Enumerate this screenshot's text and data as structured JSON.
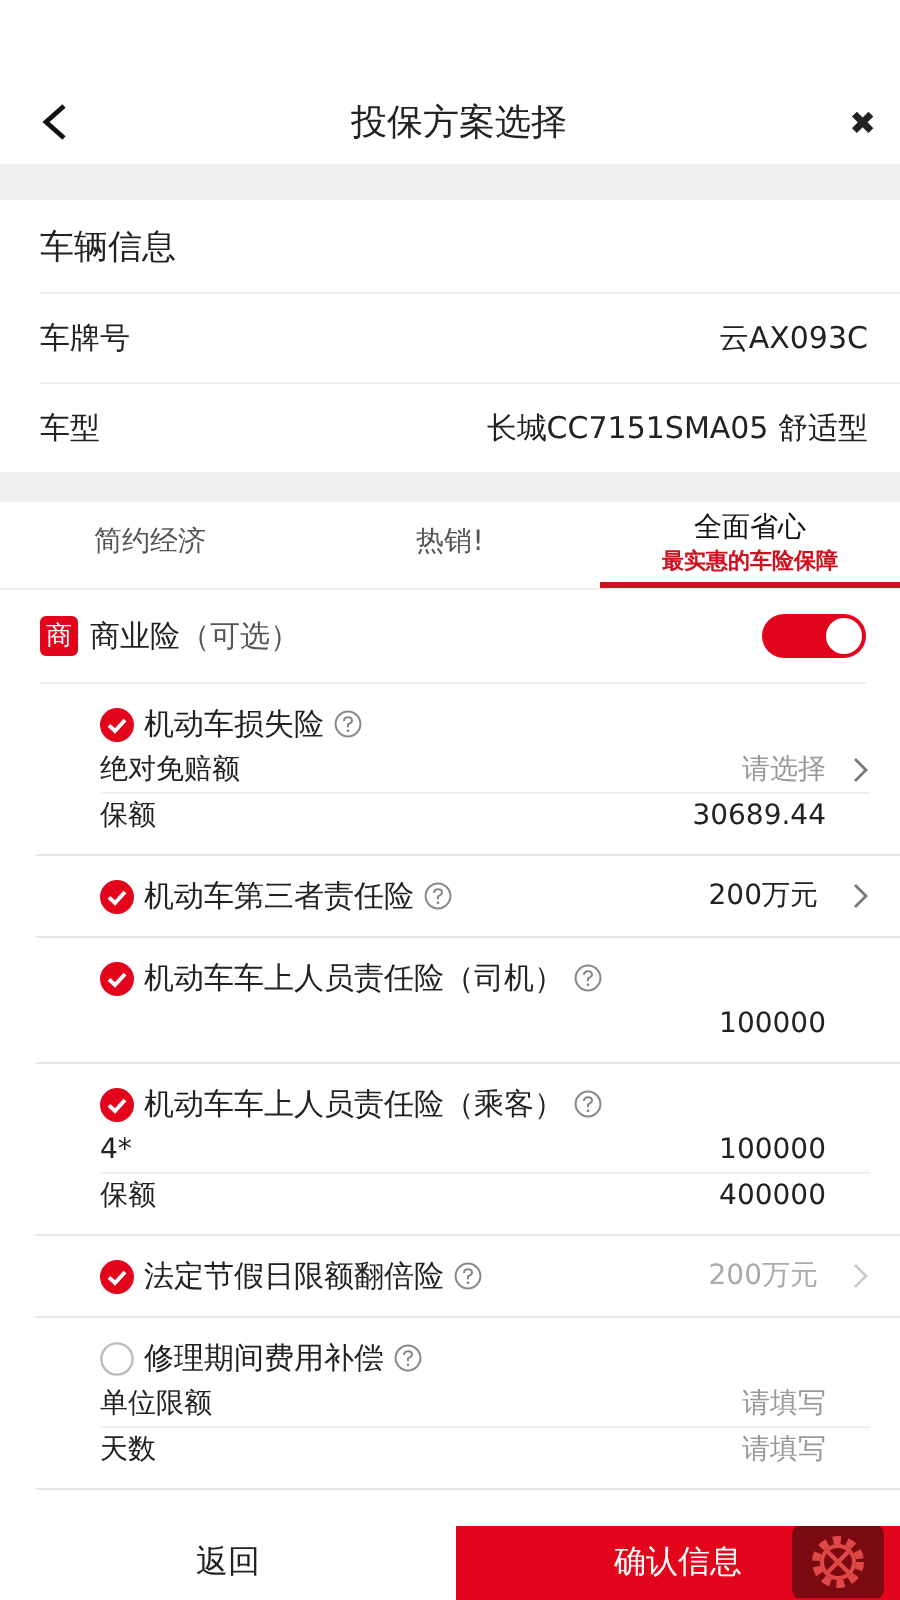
{
  "header": {
    "title": "投保方案选择",
    "close": "✖"
  },
  "vehicle": {
    "heading": "车辆信息",
    "rows": [
      {
        "label": "车牌号",
        "value": "云AX093C"
      },
      {
        "label": "车型",
        "value": "长城CC7151SMA05 舒适型"
      }
    ]
  },
  "tabs": [
    {
      "label": "简约经济",
      "selected": false
    },
    {
      "label": "热销!",
      "selected": false
    },
    {
      "label": "全面省心",
      "subtitle": "最实惠的车险保障",
      "selected": true
    }
  ],
  "commercial": {
    "badge": "商",
    "label": "商业险",
    "note": "（可选）",
    "on": true
  },
  "items": [
    {
      "name": "机动车损失险",
      "checked": true,
      "rows": [
        {
          "kind": "select",
          "label": "绝对免赔额",
          "placeholder": "请选择"
        },
        {
          "kind": "text",
          "label": "保额",
          "value": "30689.44"
        }
      ]
    },
    {
      "name": "机动车第三者责任险",
      "checked": true,
      "value": {
        "text": "200万元",
        "muted": false
      }
    },
    {
      "name": "机动车车上人员责任险（司机）",
      "checked": true,
      "rows": [
        {
          "kind": "text",
          "value": "100000"
        }
      ]
    },
    {
      "name": "机动车车上人员责任险（乘客）",
      "checked": true,
      "rows": [
        {
          "kind": "text",
          "label": "4*",
          "value": "100000"
        },
        {
          "kind": "text",
          "label": "保额",
          "value": "400000"
        }
      ]
    },
    {
      "name": "法定节假日限额翻倍险",
      "checked": true,
      "value": {
        "text": "200万元",
        "muted": true
      }
    },
    {
      "name": "修理期间费用补偿",
      "checked": false,
      "rows": [
        {
          "kind": "input",
          "label": "单位限额",
          "placeholder": "请填写"
        },
        {
          "kind": "input",
          "label": "天数",
          "placeholder": "请填写"
        }
      ]
    }
  ],
  "footer": {
    "back": "返回",
    "confirm": "确认信息"
  }
}
